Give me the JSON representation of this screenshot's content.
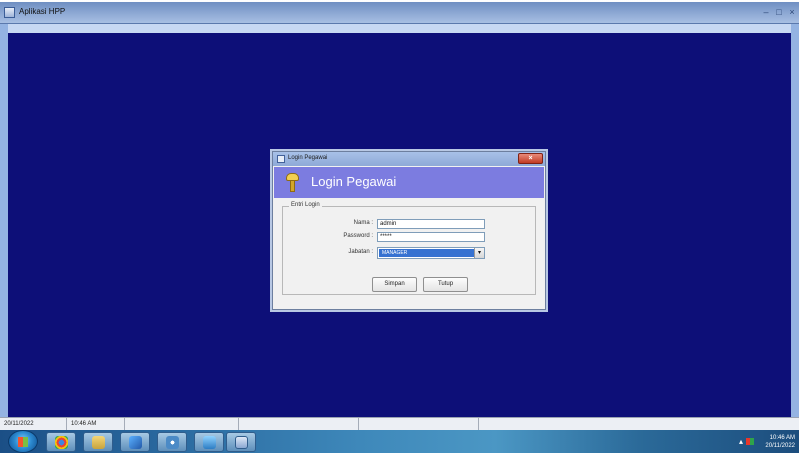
{
  "app": {
    "title": "Aplikasi HPP"
  },
  "dialog": {
    "window_title": "Login Pegawai",
    "heading": "Login Pegawai",
    "group_title": "Entri Login",
    "fields": [
      {
        "label": "Nama :",
        "value": "admin"
      },
      {
        "label": "Password :",
        "value": "*****"
      },
      {
        "label": "Jabatan :",
        "value": "MANAGER"
      }
    ],
    "buttons": {
      "save": "Simpan",
      "close": "Tutup"
    }
  },
  "statusbar": {
    "date": "20/11/2022",
    "time": "10:46 AM"
  },
  "taskbar": {
    "clock_time": "10:46 AM",
    "clock_date": "20/11/2022",
    "tray_icons": [
      "flag-icon"
    ]
  },
  "colors": {
    "desktop": "#0d0f78",
    "dialog_header": "#7c7ce0",
    "selection": "#3672d1"
  }
}
